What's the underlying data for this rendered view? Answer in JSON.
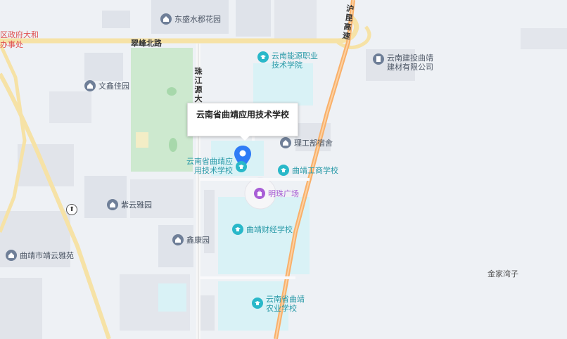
{
  "map": {
    "selected_place": {
      "callout_title": "云南省曲靖应用技术学校",
      "marker_label": "云南省曲靖应用技术学校"
    },
    "roads": {
      "cuifeng_north": "翠峰北路",
      "hukun_expressway": "沪昆高速",
      "zhujiangyuan": "珠江源大"
    },
    "pois": [
      {
        "id": "dongsheng",
        "text": "东盛水郡花园",
        "kind": "residential"
      },
      {
        "id": "energy-college",
        "text": "云南能源职业技术学院",
        "kind": "education"
      },
      {
        "id": "jianshe",
        "text": "云南建投曲靖建材有限公司",
        "kind": "residential"
      },
      {
        "id": "wenxin",
        "text": "文鑫佳园",
        "kind": "residential"
      },
      {
        "id": "ligong",
        "text": "理工部宿舍",
        "kind": "residential"
      },
      {
        "id": "business-school",
        "text": "曲靖工商学校",
        "kind": "education"
      },
      {
        "id": "mingzhu",
        "text": "明珠广场",
        "kind": "mall"
      },
      {
        "id": "ziyun",
        "text": "紫云雅园",
        "kind": "residential"
      },
      {
        "id": "finance-school",
        "text": "曲靖财经学校",
        "kind": "education"
      },
      {
        "id": "xinkang",
        "text": "鑫康园",
        "kind": "residential"
      },
      {
        "id": "jingyun",
        "text": "曲靖市靖云雅苑",
        "kind": "residential"
      },
      {
        "id": "agri-school",
        "text": "云南省曲靖农业学校",
        "kind": "education"
      }
    ],
    "area_labels": {
      "jinjiawanzi": "金家湾子",
      "district_gov": "区政府大和",
      "office": "办事处"
    },
    "colors": {
      "background": "#eef1f5",
      "park": "#cde9cf",
      "campus": "#d9f2f6",
      "highway": "#f9b06a",
      "road_yellow": "#f6e2a6",
      "marker": "#2f7cf6"
    }
  }
}
